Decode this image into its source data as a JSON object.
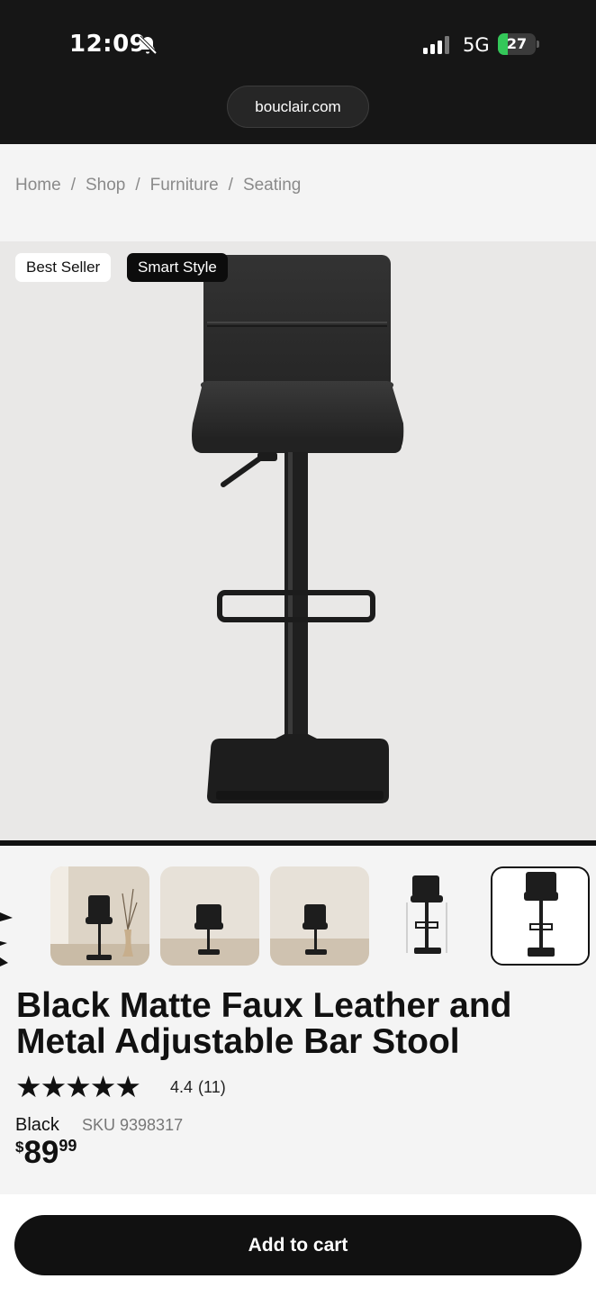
{
  "status_bar": {
    "time": "12:09",
    "network": "5G",
    "battery": "27",
    "battery_fraction": 0.27
  },
  "browser": {
    "url": "bouclair.com"
  },
  "breadcrumb": [
    "Home",
    "Shop",
    "Furniture",
    "Seating"
  ],
  "badges": {
    "best_seller": "Best Seller",
    "smart_style": "Smart Style"
  },
  "product": {
    "title": "Black Matte Faux Leather and Metal Adjustable Bar Stool",
    "rating_value": "4.4",
    "rating_count": "(11)",
    "rating_fraction": 0.88,
    "color": "Black",
    "sku_label": "SKU",
    "sku": "9398317",
    "price": {
      "currency": "$",
      "dollars": "89",
      "cents": "99"
    }
  },
  "gallery": {
    "thumb_count": 5,
    "selected_index": 4
  },
  "cart": {
    "button_label": "Add to cart"
  },
  "icons": [
    "bell-slash-icon",
    "cellular-signal-icon",
    "battery-icon",
    "star-icon"
  ],
  "colors": {
    "status_bar_bg": "#161616",
    "accent": "#111111",
    "hero_bg": "#e9e8e7",
    "battery_green": "#34c759"
  }
}
